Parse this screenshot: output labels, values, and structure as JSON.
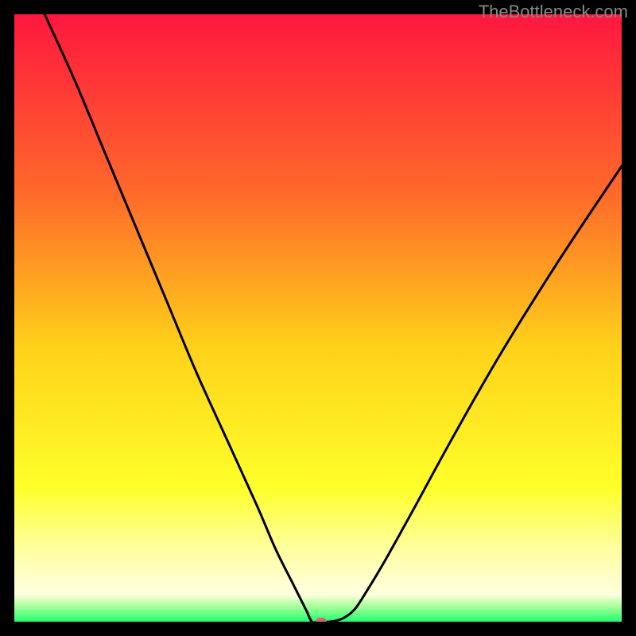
{
  "watermark": "TheBottleneck.com",
  "chart_data": {
    "type": "line",
    "title": "",
    "xlabel": "",
    "ylabel": "",
    "xlim": [
      0,
      100
    ],
    "ylim": [
      0,
      100
    ],
    "gradient_stops": [
      {
        "offset": 0.0,
        "color": "#ff173f"
      },
      {
        "offset": 0.3,
        "color": "#ff6b2a"
      },
      {
        "offset": 0.55,
        "color": "#ffd21a"
      },
      {
        "offset": 0.78,
        "color": "#ffff2a"
      },
      {
        "offset": 0.88,
        "color": "#ffffa0"
      },
      {
        "offset": 0.955,
        "color": "#ffffe0"
      },
      {
        "offset": 0.975,
        "color": "#a8ff9a"
      },
      {
        "offset": 1.0,
        "color": "#1eff6d"
      }
    ],
    "series": [
      {
        "name": "bottleneck-curve",
        "x": [
          5,
          10,
          15,
          20,
          25,
          30,
          35,
          40,
          43,
          46,
          48,
          49,
          50,
          52,
          54,
          56,
          58,
          61,
          66,
          72,
          80,
          90,
          100
        ],
        "y": [
          100,
          89,
          77,
          65,
          53,
          41,
          30,
          19,
          12,
          6,
          2,
          0,
          0,
          0,
          0.5,
          2,
          5,
          10,
          19,
          30,
          44,
          60,
          75
        ]
      }
    ],
    "marker": {
      "x": 50.5,
      "y": 0
    }
  }
}
